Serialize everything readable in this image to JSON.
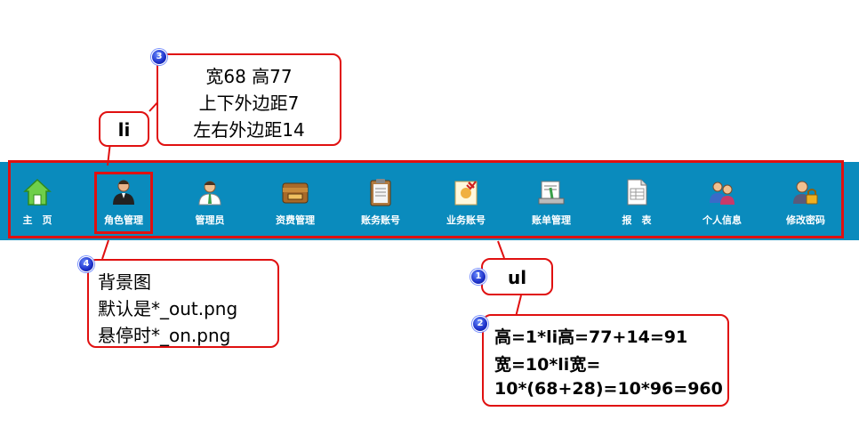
{
  "nav": {
    "items": [
      {
        "label": "主　页",
        "icon": "home-icon"
      },
      {
        "label": "角色管理",
        "icon": "role-person-icon"
      },
      {
        "label": "管理员",
        "icon": "admin-person-icon"
      },
      {
        "label": "资费管理",
        "icon": "fee-box-icon"
      },
      {
        "label": "账务账号",
        "icon": "clipboard-icon"
      },
      {
        "label": "业务账号",
        "icon": "certificate-icon"
      },
      {
        "label": "账单管理",
        "icon": "bill-icon"
      },
      {
        "label": "报　表",
        "icon": "report-icon"
      },
      {
        "label": "个人信息",
        "icon": "users-icon"
      },
      {
        "label": "修改密码",
        "icon": "lock-person-icon"
      }
    ]
  },
  "callouts": {
    "li_label": "li",
    "li_spec": [
      "宽68 高77",
      "上下外边距7",
      "左右外边距14"
    ],
    "ul_label": "ul",
    "ul_spec": [
      "高=1*li高=77+14=91",
      "宽=10*li宽=",
      "10*(68+28)=10*96=960"
    ],
    "bg_spec": [
      "背景图",
      "默认是*_out.png",
      "悬停时*_on.png"
    ]
  },
  "badges": [
    "1",
    "2",
    "3",
    "4"
  ]
}
